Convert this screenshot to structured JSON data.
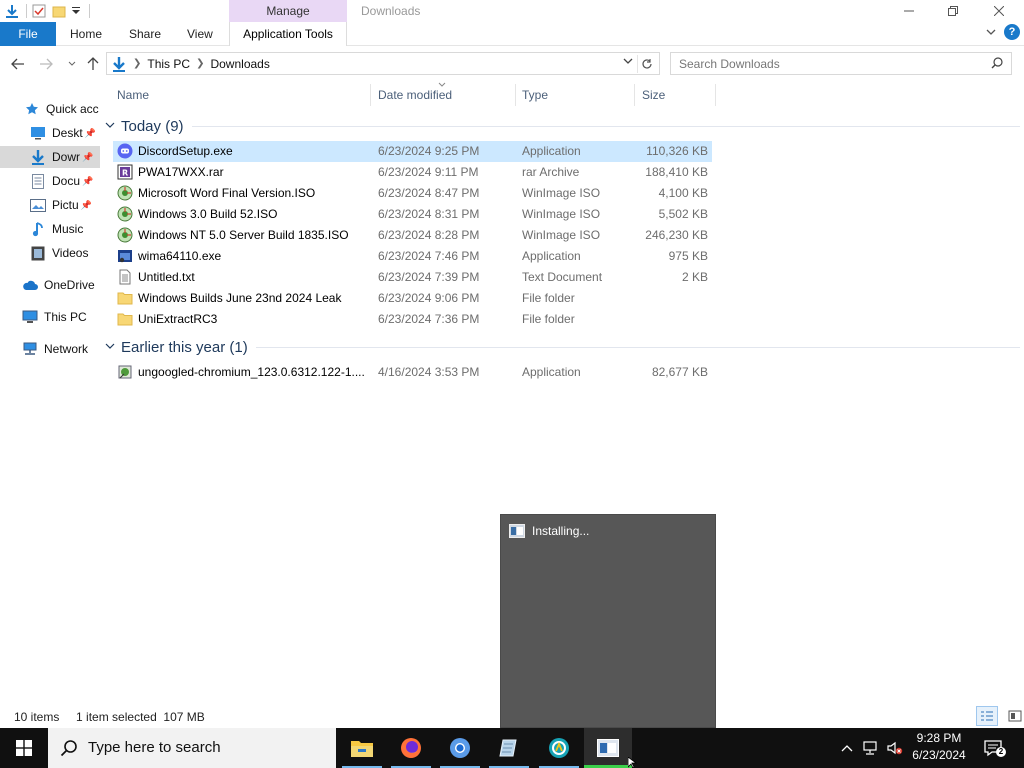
{
  "window": {
    "title": "Downloads",
    "context_tab": "Manage",
    "quick_access_toolbar": [
      "downloads-icon",
      "properties-icon",
      "new-folder-icon",
      "customize-qat-icon"
    ],
    "controls": [
      "minimize",
      "restore",
      "close"
    ]
  },
  "ribbon": {
    "file": "File",
    "tabs": [
      "Home",
      "Share",
      "View"
    ],
    "context_subtab": "Application Tools"
  },
  "address": {
    "segments": [
      "This PC",
      "Downloads"
    ],
    "search_placeholder": "Search Downloads"
  },
  "nav_pane": {
    "quick_access": "Quick acc",
    "items": [
      {
        "label": "Deskt",
        "icon": "desktop-icon",
        "pinned": true
      },
      {
        "label": "Dowr",
        "icon": "downloads-icon",
        "pinned": true,
        "selected": true
      },
      {
        "label": "Docu",
        "icon": "documents-icon",
        "pinned": true
      },
      {
        "label": "Pictu",
        "icon": "pictures-icon",
        "pinned": true
      },
      {
        "label": "Music",
        "icon": "music-icon",
        "pinned": false
      },
      {
        "label": "Videos",
        "icon": "videos-icon",
        "pinned": false
      }
    ],
    "onedrive": "OneDrive",
    "this_pc": "This PC",
    "network": "Network"
  },
  "columns": [
    "Name",
    "Date modified",
    "Type",
    "Size"
  ],
  "groups": [
    {
      "label": "Today (9)",
      "files": [
        {
          "name": "DiscordSetup.exe",
          "date": "6/23/2024 9:25 PM",
          "type": "Application",
          "size": "110,326 KB",
          "icon": "discord-icon",
          "selected": true
        },
        {
          "name": "PWA17WXX.rar",
          "date": "6/23/2024 9:11 PM",
          "type": "rar Archive",
          "size": "188,410 KB",
          "icon": "rar-icon"
        },
        {
          "name": "Microsoft Word Final Version.ISO",
          "date": "6/23/2024 8:47 PM",
          "type": "WinImage ISO",
          "size": "4,100 KB",
          "icon": "iso-icon"
        },
        {
          "name": "Windows 3.0 Build 52.ISO",
          "date": "6/23/2024 8:31 PM",
          "type": "WinImage ISO",
          "size": "5,502 KB",
          "icon": "iso-icon"
        },
        {
          "name": "Windows NT 5.0 Server Build 1835.ISO",
          "date": "6/23/2024 8:28 PM",
          "type": "WinImage ISO",
          "size": "246,230 KB",
          "icon": "iso-icon"
        },
        {
          "name": "wima64110.exe",
          "date": "6/23/2024 7:46 PM",
          "type": "Application",
          "size": "975 KB",
          "icon": "exe-icon"
        },
        {
          "name": "Untitled.txt",
          "date": "6/23/2024 7:39 PM",
          "type": "Text Document",
          "size": "2 KB",
          "icon": "text-file-icon"
        },
        {
          "name": "Windows Builds June 23nd 2024 Leak",
          "date": "6/23/2024 9:06 PM",
          "type": "File folder",
          "size": "",
          "icon": "folder-icon"
        },
        {
          "name": "UniExtractRC3",
          "date": "6/23/2024 7:36 PM",
          "type": "File folder",
          "size": "",
          "icon": "folder-icon"
        }
      ]
    },
    {
      "label": "Earlier this year (1)",
      "files": [
        {
          "name": "ungoogled-chromium_123.0.6312.122-1....",
          "date": "4/16/2024 3:53 PM",
          "type": "Application",
          "size": "82,677 KB",
          "icon": "installer-icon"
        }
      ]
    }
  ],
  "status": {
    "count": "10 items",
    "selection": "1 item selected  107 MB"
  },
  "popup": {
    "title": "Installing..."
  },
  "taskbar": {
    "search_placeholder": "Type here to search",
    "apps": [
      "file-explorer-icon",
      "firefox-icon",
      "chromium-icon",
      "notepad-icon",
      "arduino-icon",
      "installer-window-icon"
    ],
    "clock_time": "9:28 PM",
    "clock_date": "6/23/2024",
    "notification_count": "2"
  },
  "colors": {
    "accent": "#1979ca",
    "selection": "#cce8ff",
    "manage_tab": "#e9d8f5",
    "group_text": "#1e395b",
    "taskbar": "#101010",
    "popup": "#575757"
  }
}
